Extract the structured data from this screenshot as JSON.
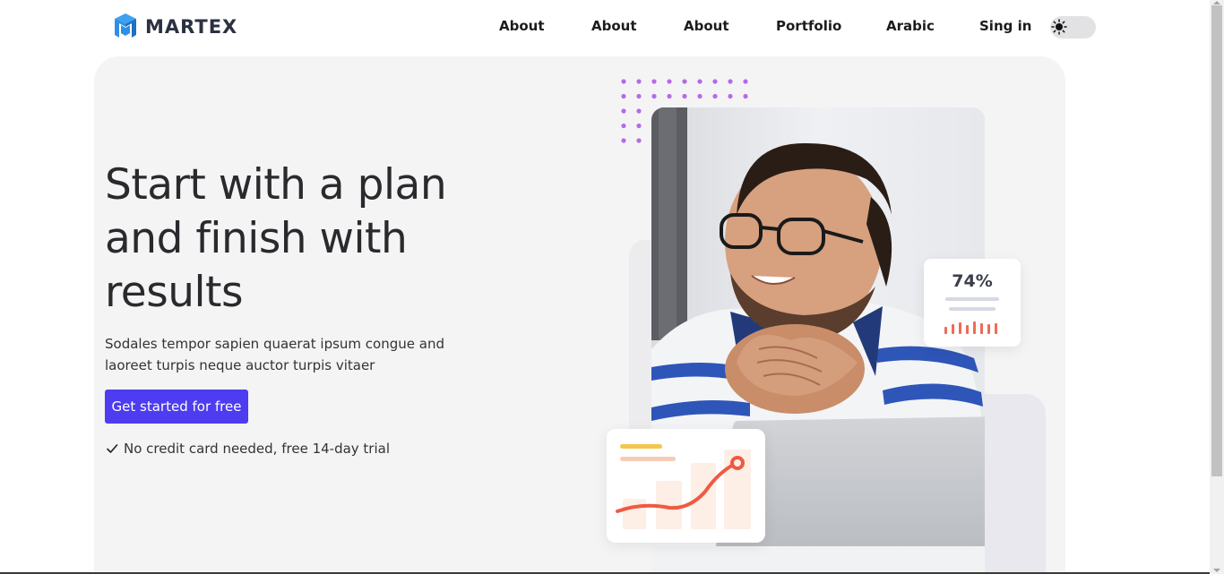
{
  "header": {
    "logo_text": "MARTEX",
    "nav": [
      {
        "label": "About"
      },
      {
        "label": "About"
      },
      {
        "label": "About"
      },
      {
        "label": "Portfolio"
      },
      {
        "label": "Arabic"
      },
      {
        "label": "Sing in"
      }
    ],
    "theme_toggle_icon": "sun-icon"
  },
  "hero": {
    "title": "Start with a plan and finish with results",
    "description": "Sodales tempor sapien quaerat ipsum congue and laoreet turpis neque auctor turpis vitaer",
    "cta_label": "Get started for free",
    "trial_text": "No credit card needed, free 14-day trial"
  },
  "stat_card": {
    "value": "74%"
  },
  "colors": {
    "accent": "#4d3cf0",
    "logo_blue": "#2f8fe5",
    "hero_bg": "#f4f4f5",
    "dots": "#b66ae8",
    "graph_line": "#ef5a42"
  }
}
